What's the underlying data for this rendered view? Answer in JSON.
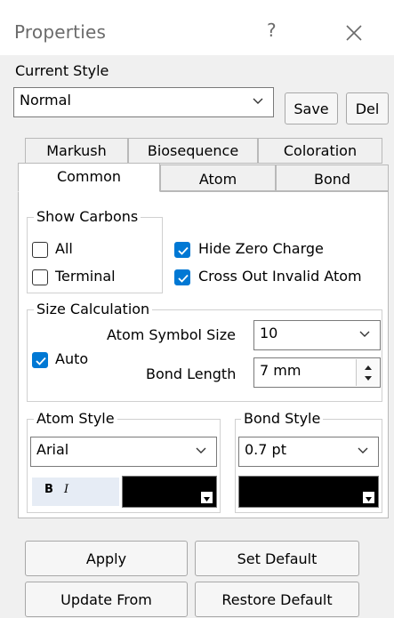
{
  "window": {
    "title": "Properties",
    "help": "?"
  },
  "current_style": {
    "label": "Current Style",
    "value": "Normal",
    "save": "Save",
    "del": "Del"
  },
  "tabs": {
    "row1": [
      "Markush",
      "Biosequence",
      "Coloration"
    ],
    "row2": [
      "Common",
      "Atom",
      "Bond"
    ],
    "active": "Common"
  },
  "show_carbons": {
    "legend": "Show Carbons",
    "all": "All",
    "terminal": "Terminal",
    "all_checked": false,
    "terminal_checked": false
  },
  "options": {
    "hide_zero_charge": "Hide Zero Charge",
    "cross_out": "Cross Out Invalid Atom",
    "hide_zero_charge_checked": true,
    "cross_out_checked": true
  },
  "size_calc": {
    "legend": "Size Calculation",
    "auto": "Auto",
    "auto_checked": true,
    "atom_symbol_size_label": "Atom Symbol Size",
    "atom_symbol_size": "10",
    "bond_length_label": "Bond Length",
    "bond_length": "7 mm"
  },
  "atom_style": {
    "legend": "Atom Style",
    "font": "Arial",
    "bold": "B",
    "italic": "I",
    "color": "#000000"
  },
  "bond_style": {
    "legend": "Bond Style",
    "width": "0.7 pt",
    "color": "#000000"
  },
  "buttons": {
    "apply": "Apply",
    "set_default": "Set Default",
    "update_from": "Update From",
    "restore_default": "Restore Default"
  },
  "colors": {
    "accent": "#0078d4",
    "dialog_bg": "#f0f0f0"
  }
}
